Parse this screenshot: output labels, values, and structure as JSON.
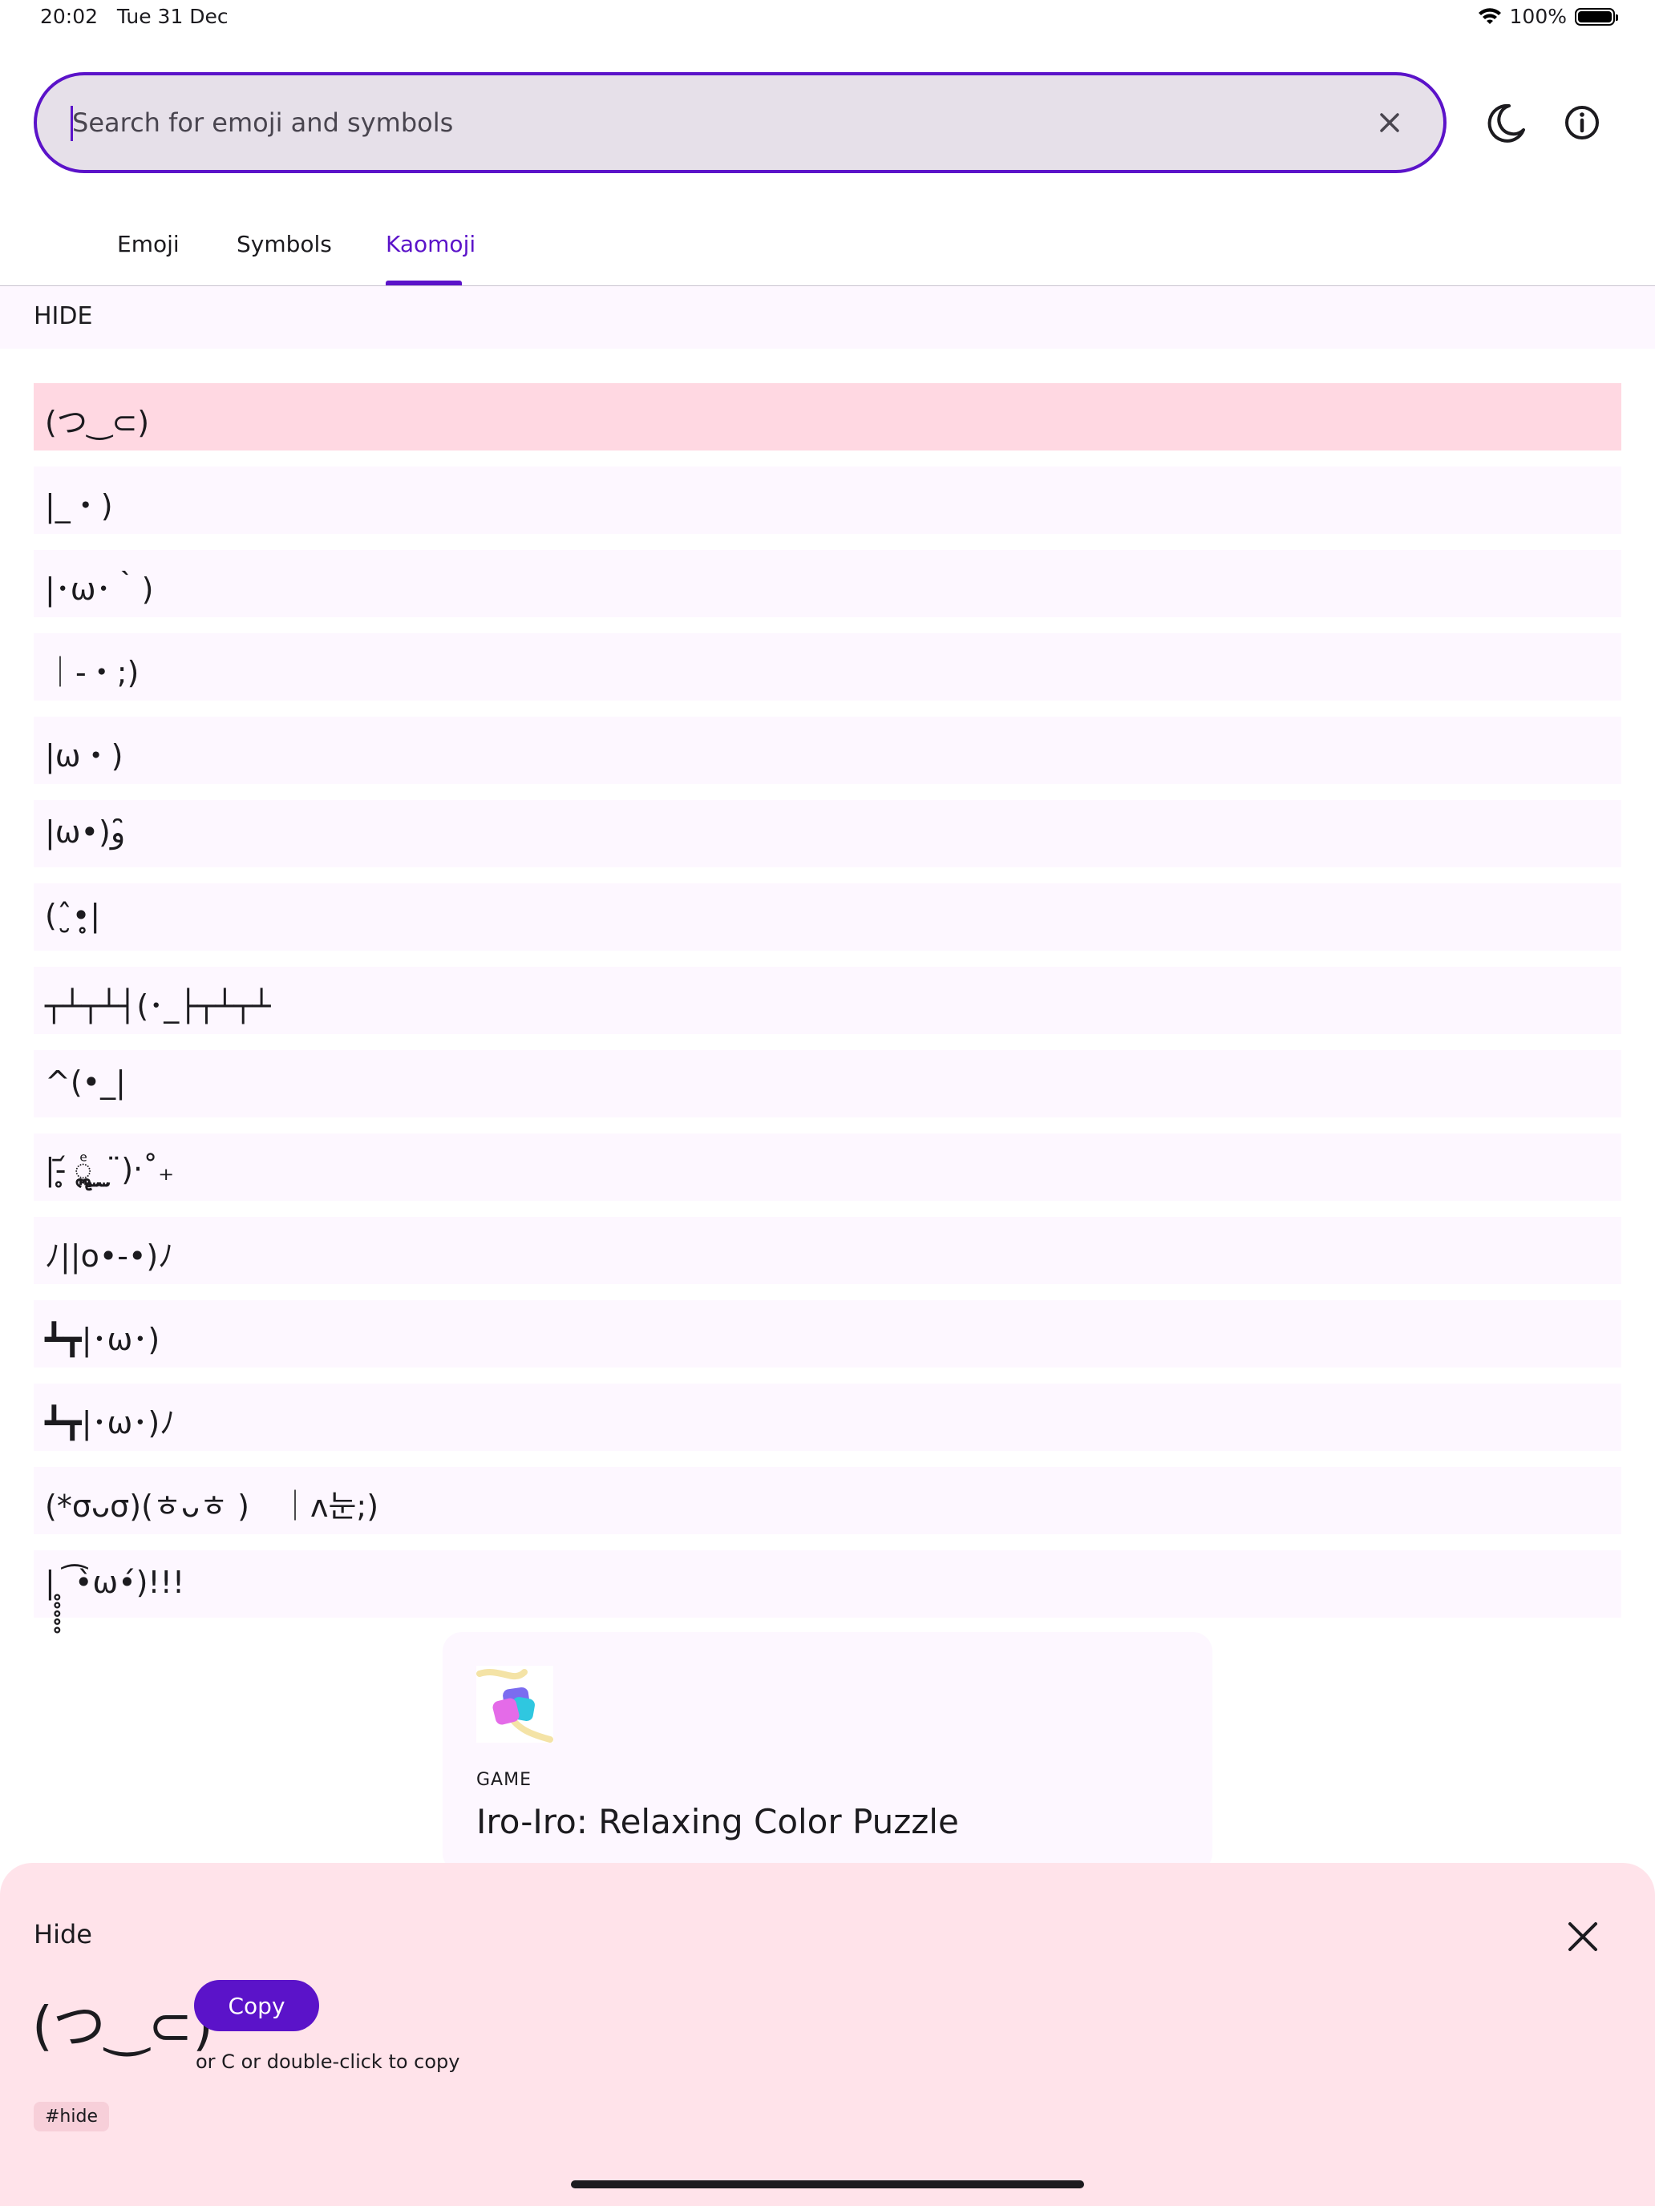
{
  "status_bar": {
    "time": "20:02",
    "date": "Tue 31 Dec",
    "battery": "100%"
  },
  "search": {
    "placeholder": "Search for emoji and symbols",
    "value": ""
  },
  "icons": {
    "clear": "close-icon",
    "theme": "moon-icon",
    "info": "info-icon",
    "wifi": "wifi-icon"
  },
  "tabs": [
    {
      "label": "Emoji",
      "active": false
    },
    {
      "label": "Symbols",
      "active": false
    },
    {
      "label": "Kaomoji",
      "active": true
    }
  ],
  "section": {
    "title": "HIDE"
  },
  "kaomoji": [
    "(つ‿⊂)",
    "|_・)",
    "|･ω･｀)",
    "｜-・;)",
    "|ω・)",
    "|ω•)و ̑̑",
    "(ˆ̮•̥̥|",
    "┬┴┬┴┤(･_├┬┴┬┴",
    "^(•_|",
    "|-̥̥᷄ ॣॢ͈ͤ ̫̮ ̫̮ ̈)‧˚₊",
    "ﾉ||o•-•)ﾉ",
    "┻┳|･ω･)",
    "┻┳|･ω･)ﾉ",
    "(*σᴗσ)(ㅎᴗㅎ )　｜ᴧ눈;)",
    "| ̥̥̥̥̥ ͡•̀ω•́)!!!"
  ],
  "ad": {
    "category": "GAME",
    "title": "Iro-Iro: Relaxing Color Puzzle"
  },
  "sheet": {
    "title": "Hide",
    "kaomoji": "(つ‿⊂)",
    "copy_label": "Copy",
    "hint": "or  C or double-click to copy",
    "tag": "#hide"
  },
  "colors": {
    "accent": "#5b13c9",
    "selected_row": "#ffd8e2",
    "sheet_bg": "#ffe3ea",
    "row_bg": "#fdf7ff"
  }
}
